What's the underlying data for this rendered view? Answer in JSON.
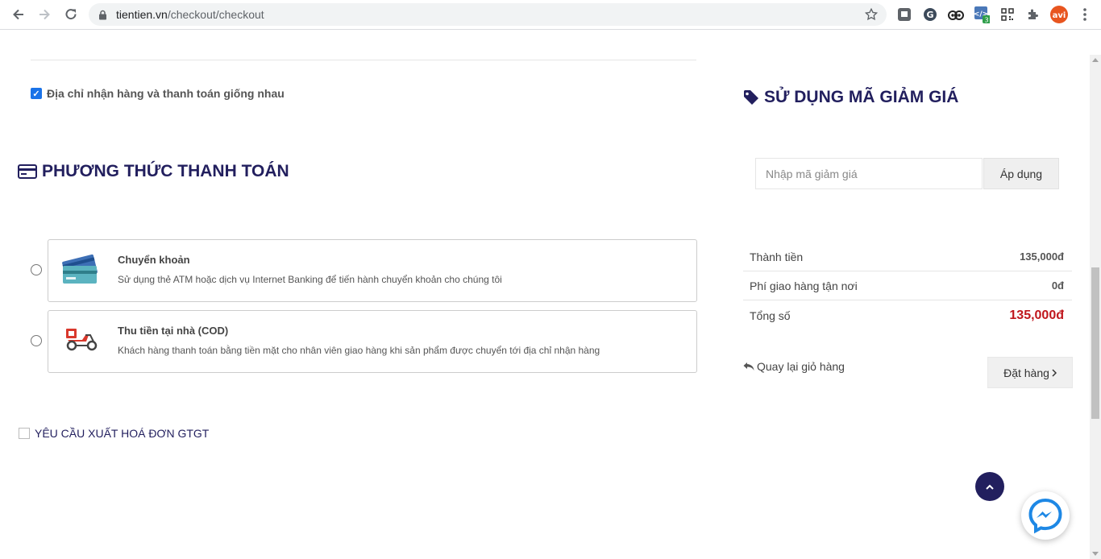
{
  "browser": {
    "url_host": "tientien.vn",
    "url_path": "/checkout/checkout",
    "extensions": [
      "bookmark-ext-icon",
      "grammar-ext-icon",
      "tripadvisor-icon",
      "code-ext-icon",
      "qr-code-icon",
      "puzzle-icon",
      "avatar-icon"
    ],
    "ext_badge": "3",
    "avatar_text": "avi"
  },
  "billing": {
    "same_address_label": "Địa chỉ nhận hàng và thanh toán giống nhau",
    "same_address_checked": true
  },
  "payment": {
    "title": "PHƯƠNG THỨC THANH TOÁN",
    "options": [
      {
        "name": "Chuyển khoản",
        "description": "Sử dụng thẻ ATM hoặc dịch vụ Internet Banking để tiến hành chuyển khoản cho chúng tôi",
        "icon": "bank-card-icon"
      },
      {
        "name": "Thu tiền tại nhà (COD)",
        "description": "Khách hàng thanh toán bằng tiền mặt cho nhân viên giao hàng khi sản phẩm được chuyển tới địa chỉ nhận hàng",
        "icon": "delivery-scooter-icon"
      }
    ]
  },
  "vat": {
    "label": "YÊU CẦU XUẤT HOÁ ĐƠN GTGT",
    "checked": false
  },
  "coupon": {
    "title": "SỬ DỤNG MÃ GIẢM GIÁ",
    "placeholder": "Nhập mã giảm giá",
    "apply_label": "Áp dụng"
  },
  "summary": {
    "rows": [
      {
        "label": "Thành tiền",
        "value": "135,000đ"
      },
      {
        "label": "Phí giao hàng tận nơi",
        "value": "0đ"
      },
      {
        "label": "Tổng số",
        "value": "135,000đ"
      }
    ],
    "back_label": "Quay lại giỏ hàng",
    "order_label": "Đặt hàng",
    "total_color": "#c0171d"
  },
  "colors": {
    "brand": "#221f5e",
    "checkbox": "#1a73e8",
    "messenger": "#1e88e5"
  }
}
